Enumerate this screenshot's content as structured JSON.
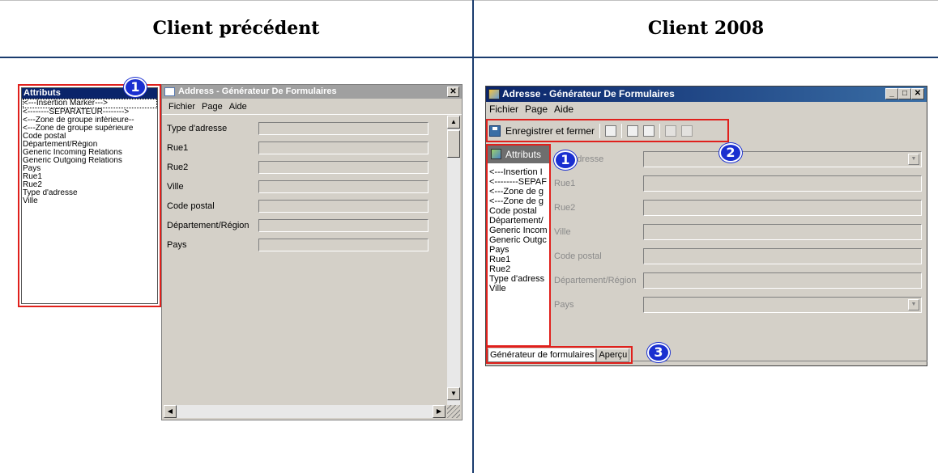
{
  "headers": {
    "left": "Client précédent",
    "right": "Client 2008"
  },
  "accent_colors": {
    "highlight_box": "#e0201c",
    "badge": "#1a2fd0",
    "divider": "#1a3c6e"
  },
  "old_client": {
    "attributes_title": "Attributs",
    "attributes": [
      "<---Insertion Marker--->",
      "<--------SEPARATEUR-------->",
      "<---Zone de groupe inférieure--",
      "<---Zone de groupe supérieure",
      "Code postal",
      "Département/Région",
      "Generic Incoming Relations",
      "Generic Outgoing Relations",
      "Pays",
      "Rue1",
      "Rue2",
      "Type d'adresse",
      "Ville"
    ],
    "window_title": "Address - Générateur De Formulaires",
    "close_label": "✕",
    "menu": [
      "Fichier",
      "Page",
      "Aide"
    ],
    "fields": [
      "Type d'adresse",
      "Rue1",
      "Rue2",
      "Ville",
      "Code postal",
      "Département/Région",
      "Pays"
    ],
    "badge": "1"
  },
  "new_client": {
    "window_title": "Adresse - Générateur De Formulaires",
    "window_buttons": [
      "_",
      "□",
      "✕"
    ],
    "menu": [
      "Fichier",
      "Page",
      "Aide"
    ],
    "toolbar_save": "Enregistrer et fermer",
    "attributes_title": "Attributs",
    "attributes": [
      "<---Insertion I",
      "<--------SEPAF",
      "<---Zone de g",
      "<---Zone de g",
      "Code postal",
      "Département/",
      "Generic Incom",
      "Generic Outgc",
      "Pays",
      "Rue1",
      "Rue2",
      "Type d'adress",
      "Ville"
    ],
    "fields": [
      "'adresse",
      "Rue1",
      "Rue2",
      "Ville",
      "Code postal",
      "Département/Région",
      "Pays"
    ],
    "tabs": [
      "Générateur de formulaires",
      "Aperçu"
    ],
    "badges": [
      "1",
      "2",
      "3"
    ]
  }
}
